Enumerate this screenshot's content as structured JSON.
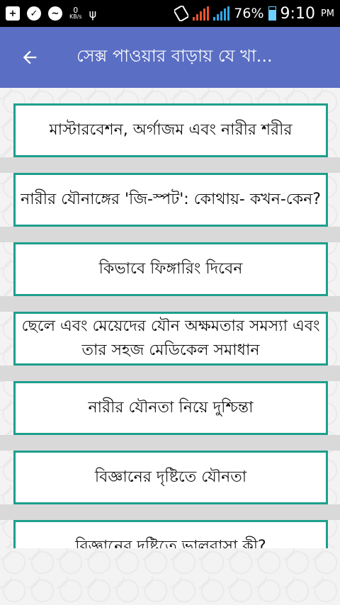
{
  "status_bar": {
    "icons": [
      "plus-box-icon",
      "check-circle-icon",
      "messenger-icon",
      "usb-icon",
      "sim-icon"
    ],
    "net_speed": "0",
    "net_unit": "KB/s",
    "battery": "76%",
    "time": "9:10",
    "ampm": "PM"
  },
  "app_bar": {
    "back_icon": "arrow-left-icon",
    "title": "সেক্স পাওয়ার বাড়ায় যে খা..."
  },
  "articles": [
    "মাস্টারবেশন, অর্গাজম এবং নারীর শরীর",
    "নারীর যৌনাঙ্গের 'জি-স্পট': কোথায়- কখন-কেন?",
    "কিভাবে ফিঙ্গারিং দিবেন",
    "ছেলে এবং মেয়েদের যৌন অক্ষমতার সমস্যা এবং তার সহজ মেডিকেল সমাধান",
    "নারীর যৌনতা নিয়ে দুশ্চিন্তা",
    "বিজ্ঞানের দৃষ্টিতে যৌনতা",
    "বিজ্ঞানের দৃষ্টিতে ভালবাসা কী?"
  ],
  "colors": {
    "app_bar": "#5a6ec4",
    "card_border": "#1e9f8c",
    "signal": "#e8552d",
    "signal2": "#2fa9e6"
  }
}
